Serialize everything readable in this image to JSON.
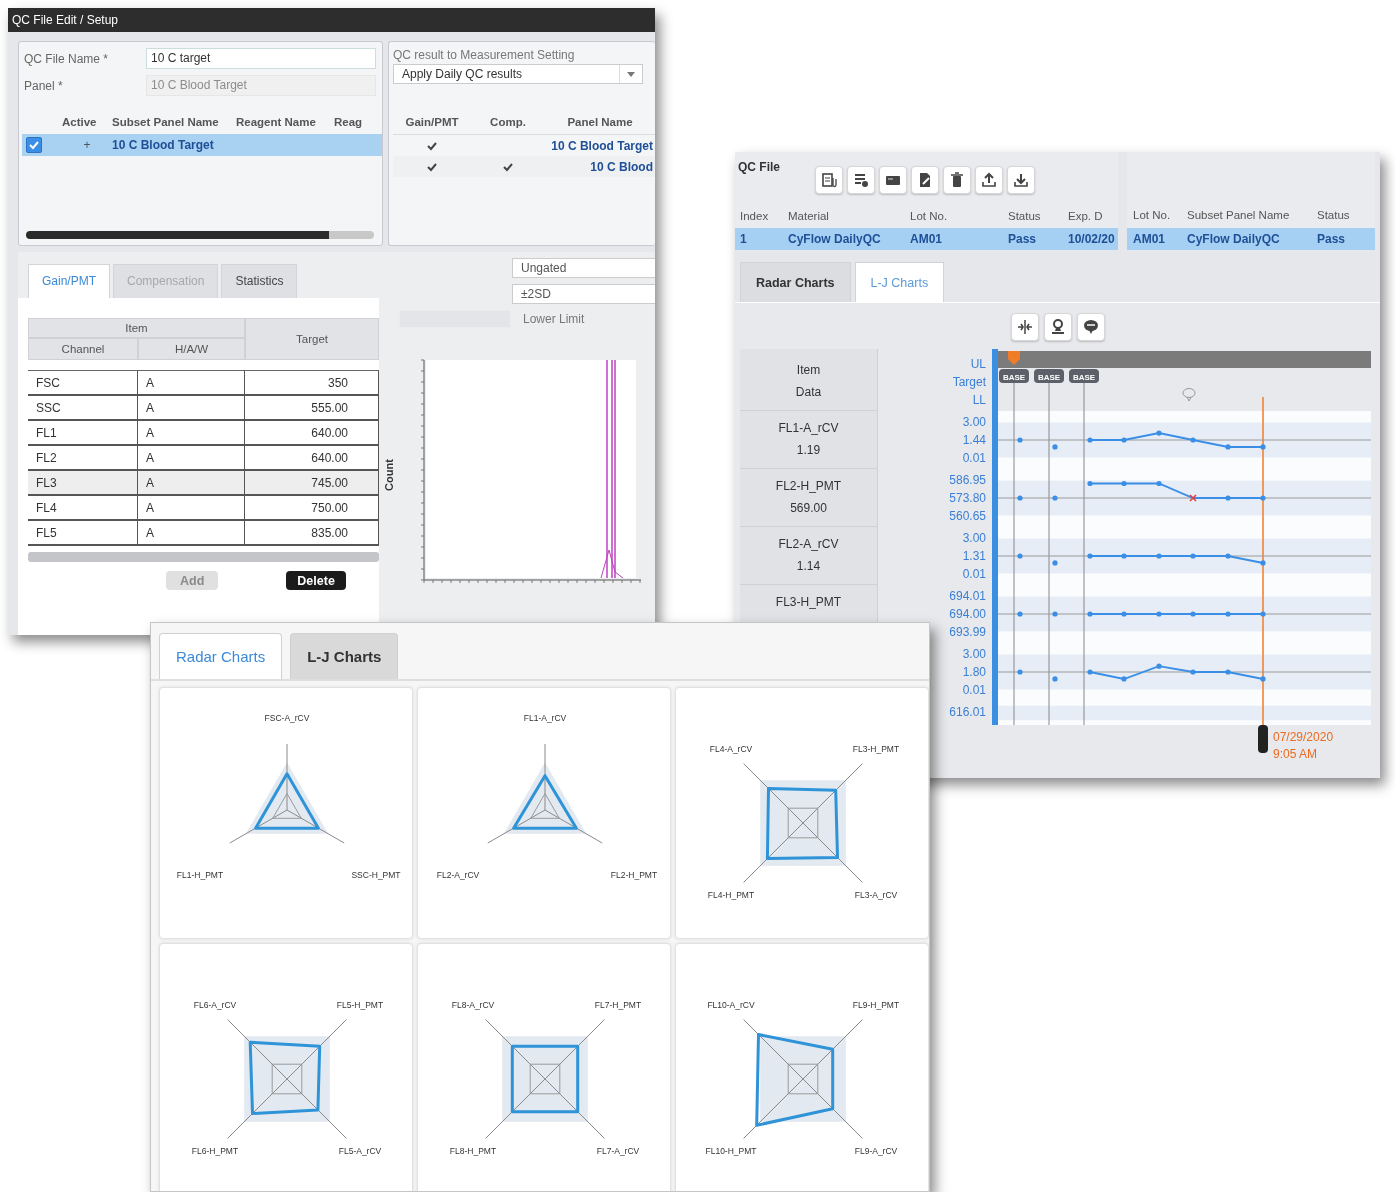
{
  "qc_file_edit": {
    "title": "QC File Edit / Setup",
    "fields": [
      {
        "label": "QC File Name *",
        "value": "10 C target",
        "disabled": false
      },
      {
        "label": "Panel *",
        "value": "10 C Blood Target",
        "disabled": true
      }
    ],
    "subset_table": {
      "columns": [
        "Active",
        "Subset Panel Name",
        "Reagent Name",
        "Reag"
      ],
      "rows": [
        {
          "active": true,
          "expander": "+",
          "subset_panel_name": "10 C Blood Target",
          "selected": true
        }
      ]
    },
    "measurement_setting": {
      "label": "QC result to Measurement Setting",
      "value": "Apply Daily QC results"
    },
    "panel_table": {
      "columns": [
        "Gain/PMT",
        "Comp.",
        "Panel Name"
      ],
      "rows": [
        {
          "gain_pmt": true,
          "comp": false,
          "panel_name": "10 C Blood Target"
        },
        {
          "gain_pmt": true,
          "comp": true,
          "panel_name": "10 C Blood"
        }
      ]
    },
    "tabs": [
      {
        "label": "Gain/PMT",
        "selected": true,
        "disabled": false
      },
      {
        "label": "Compensation",
        "selected": false,
        "disabled": true
      },
      {
        "label": "Statistics",
        "selected": false,
        "disabled": false
      }
    ],
    "target_table": {
      "group": "Item",
      "columns": [
        "Channel",
        "H/A/W",
        "Target"
      ],
      "rows": [
        {
          "channel": "FSC",
          "haw": "A",
          "target": "350",
          "selected": false
        },
        {
          "channel": "SSC",
          "haw": "A",
          "target": "555.00",
          "selected": false
        },
        {
          "channel": "FL1",
          "haw": "A",
          "target": "640.00",
          "selected": false
        },
        {
          "channel": "FL2",
          "haw": "A",
          "target": "640.00",
          "selected": false
        },
        {
          "channel": "FL3",
          "haw": "A",
          "target": "745.00",
          "selected": true
        },
        {
          "channel": "FL4",
          "haw": "A",
          "target": "750.00",
          "selected": false
        },
        {
          "channel": "FL5",
          "haw": "A",
          "target": "835.00",
          "selected": false
        }
      ]
    },
    "buttons": [
      {
        "label": "Add",
        "disabled": true
      },
      {
        "label": "Delete",
        "disabled": false
      }
    ],
    "gate": "Ungated",
    "range": "±2SD",
    "limit_label": "Lower Limit",
    "histogram": {
      "ylabel": "Count"
    }
  },
  "qc_file_list": {
    "label": "QC File",
    "table": {
      "columns": [
        "Index",
        "Material",
        "Lot No.",
        "Status",
        "Exp. D"
      ],
      "rows": [
        {
          "cells": [
            "1",
            "CyFlow DailyQC",
            "AM01",
            "Pass",
            "10/02/20"
          ],
          "selected": true
        }
      ]
    },
    "subset_table": {
      "columns": [
        "Lot No.",
        "Subset Panel Name",
        "Status"
      ],
      "rows": [
        {
          "cells": [
            "AM01",
            "CyFlow DailyQC",
            "Pass"
          ],
          "selected": true
        }
      ]
    },
    "tabs": [
      {
        "label": "Radar Charts",
        "selected": false
      },
      {
        "label": "L-J Charts",
        "selected": true
      }
    ],
    "lj_chart": {
      "header": {
        "item": "Item",
        "data": "Data",
        "ul": "UL",
        "target": "Target",
        "ll": "LL"
      },
      "tags": [
        "BASE",
        "BASE",
        "BASE"
      ],
      "rows": [
        {
          "item": "FL1-A_rCV",
          "data": "1.19",
          "ul": "3.00",
          "target": "1.44",
          "ll": "0.01"
        },
        {
          "item": "FL2-H_PMT",
          "data": "569.00",
          "ul": "586.95",
          "target": "573.80",
          "ll": "560.65"
        },
        {
          "item": "FL2-A_rCV",
          "data": "1.14",
          "ul": "3.00",
          "target": "1.31",
          "ll": "0.01"
        },
        {
          "item": "FL3-H_PMT",
          "ul": "694.01",
          "target": "694.00",
          "ll": "693.99"
        },
        {
          "ul": "3.00",
          "target": "1.80",
          "ll": "0.01"
        },
        {
          "ul": "616.01"
        }
      ],
      "cursor": {
        "date": "07/29/2020",
        "time": "9:05 AM"
      }
    }
  },
  "radar_window": {
    "tabs": [
      {
        "label": "Radar Charts",
        "selected": true
      },
      {
        "label": "L-J Charts",
        "selected": false
      }
    ],
    "charts": [
      {
        "labels": [
          "FSC-A_rCV",
          "FL1-H_PMT",
          "SSC-H_PMT"
        ]
      },
      {
        "labels": [
          "FL1-A_rCV",
          "FL2-A_rCV",
          "FL2-H_PMT"
        ]
      },
      {
        "labels": [
          "FL4-A_rCV",
          "FL3-H_PMT",
          "FL4-H_PMT",
          "FL3-A_rCV"
        ]
      },
      {
        "labels": [
          "FL6-A_rCV",
          "FL5-H_PMT",
          "FL6-H_PMT",
          "FL5-A_rCV"
        ]
      },
      {
        "labels": [
          "FL8-A_rCV",
          "FL7-H_PMT",
          "FL8-H_PMT",
          "FL7-A_rCV"
        ]
      },
      {
        "labels": [
          "FL10-A_rCV",
          "FL9-H_PMT",
          "FL10-H_PMT",
          "FL9-A_rCV"
        ]
      }
    ]
  }
}
